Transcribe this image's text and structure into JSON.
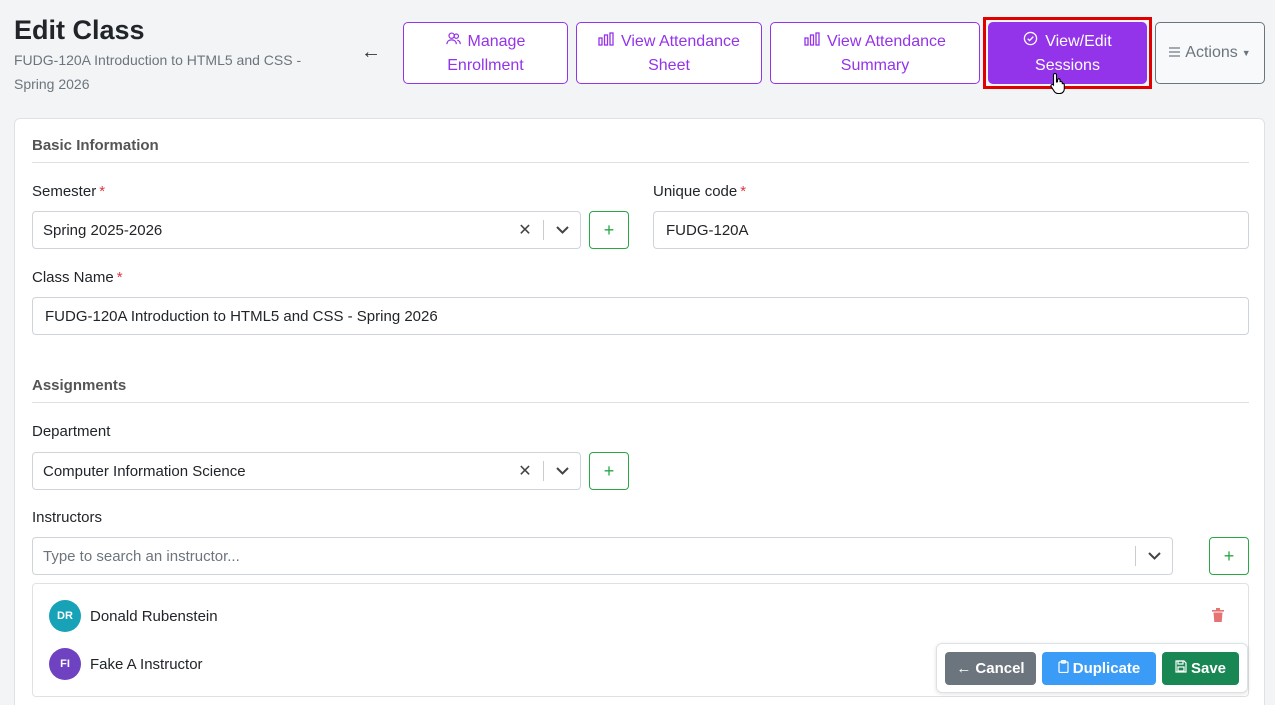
{
  "header": {
    "title": "Edit Class",
    "subtitle": "FUDG-120A Introduction to HTML5 and CSS - Spring 2026",
    "back_glyph": "←"
  },
  "toolbar": {
    "manage_line1": "Manage",
    "manage_line2": "Enrollment",
    "sheet_line1": "View Attendance",
    "sheet_line2": "Sheet",
    "summary_line1": "View Attendance",
    "summary_line2": "Summary",
    "sessions_line1": "View/Edit",
    "sessions_line2": "Sessions",
    "actions_label": "Actions"
  },
  "basic": {
    "section_title": "Basic Information",
    "semester_label": "Semester",
    "semester_value": "Spring 2025-2026",
    "unique_code_label": "Unique code",
    "unique_code_value": "FUDG-120A",
    "class_name_label": "Class Name",
    "class_name_value": "FUDG-120A Introduction to HTML5 and CSS - Spring 2026",
    "required_mark": "*"
  },
  "assignments": {
    "section_title": "Assignments",
    "department_label": "Department",
    "department_value": "Computer Information Science",
    "instructors_label": "Instructors",
    "instructors_placeholder": "Type to search an instructor...",
    "instructors": [
      {
        "initials": "DR",
        "name": "Donald Rubenstein",
        "color": "#17a2b8"
      },
      {
        "initials": "FI",
        "name": "Fake A Instructor",
        "color": "#6f42c1"
      }
    ]
  },
  "footer": {
    "cancel_label": "Cancel",
    "duplicate_label": "Duplicate",
    "save_label": "Save"
  },
  "colors": {
    "accent": "#9333ea",
    "highlight": "#e00000",
    "success": "#198754",
    "info": "#3b9cf8",
    "secondary": "#6c757d"
  }
}
